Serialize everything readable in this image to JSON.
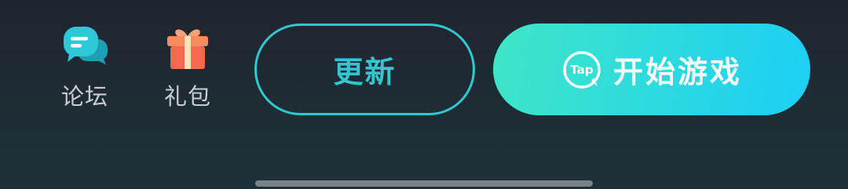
{
  "shortcuts": {
    "forum": {
      "label": "论坛",
      "icon": "chat-bubble-icon",
      "color": "#2dc7d8"
    },
    "gift": {
      "label": "礼包",
      "icon": "gift-box-icon",
      "color": "#f5694f"
    }
  },
  "buttons": {
    "update": {
      "label": "更新",
      "color": "#35c4d0"
    },
    "play": {
      "label": "开始游戏",
      "logo_text": "Tap",
      "logo_icon": "taptap-logo-icon",
      "gradient_start": "#3fe6c6",
      "gradient_end": "#1ccff6"
    }
  },
  "home_indicator": {
    "color": "#7a8189"
  }
}
